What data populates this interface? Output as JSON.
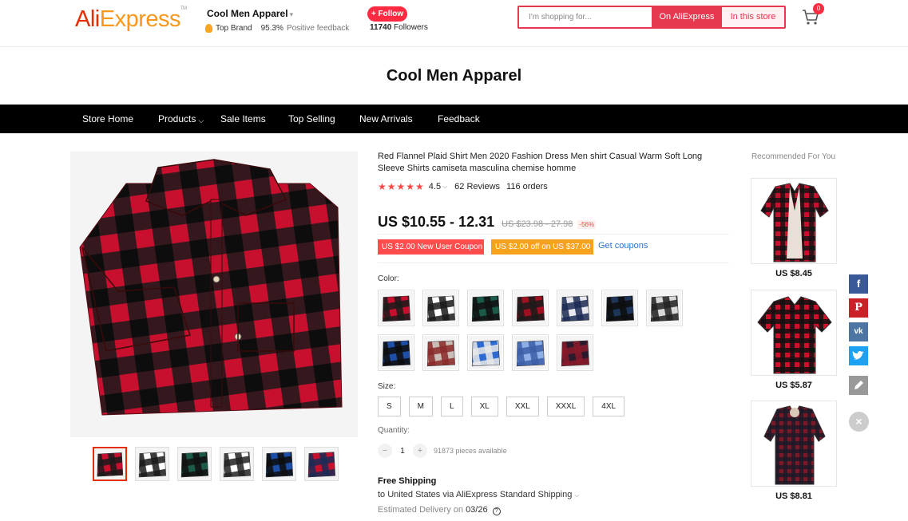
{
  "header": {
    "logo_ali": "Ali",
    "logo_express": "Express",
    "logo_tm": "TM",
    "store_name": "Cool Men Apparel",
    "top_brand": "Top Brand",
    "feedback_pct": "95.3%",
    "feedback_label": "Positive feedback",
    "follow_label": "+ Follow",
    "followers_count": "11740",
    "followers_label": "Followers",
    "search_placeholder": "I'm shopping for...",
    "search_btn_ali": "On AliExpress",
    "search_btn_store": "In this store",
    "cart_count": "0"
  },
  "banner": {
    "title": "Cool Men Apparel"
  },
  "nav": {
    "items": [
      {
        "label": "Store Home"
      },
      {
        "label": "Products"
      },
      {
        "label": "Sale Items"
      },
      {
        "label": "Top Selling"
      },
      {
        "label": "New Arrivals"
      },
      {
        "label": "Feedback"
      }
    ]
  },
  "product": {
    "title": "Red Flannel Plaid Shirt Men 2020 Fashion Dress Men shirt Casual Warm Soft Long Sleeve Shirts camiseta masculina chemise homme",
    "stars": "★★★★★",
    "rating": "4.5",
    "reviews": "62 Reviews",
    "orders": "116 orders",
    "price": "US $10.55 - 12.31",
    "old_price": "US $23.98 - 27.98",
    "discount": "-56%",
    "coupon_new_user": "US $2.00 New User Coupon",
    "coupon_off": "US $2.00 off on US $37.00",
    "get_coupons": "Get coupons",
    "color_label": "Color:",
    "size_label": "Size:",
    "sizes": [
      "S",
      "M",
      "L",
      "XL",
      "XXL",
      "XXXL",
      "4XL"
    ],
    "quantity_label": "Quantity:",
    "quantity_value": "1",
    "quantity_available": "91873 pieces available",
    "shipping_title": "Free Shipping",
    "shipping_to": "to United States via AliExpress Standard Shipping",
    "delivery_label": "Estimated Delivery on",
    "delivery_date": "03/26"
  },
  "colors": {
    "swatches": [
      {
        "c1": "#c8102e",
        "c2": "#1a1a1a",
        "bg": "#f4f4f4"
      },
      {
        "c1": "#ffffff",
        "c2": "#1a1a1a",
        "bg": "#f4f4f4"
      },
      {
        "c1": "#1c5a4a",
        "c2": "#111111",
        "bg": "#f4f4f4"
      },
      {
        "c1": "#a0101f",
        "c2": "#1a1a1a",
        "bg": "#f4f4f4"
      },
      {
        "c1": "#e8e8ee",
        "c2": "#1b2a55",
        "bg": "#f4f4f4"
      },
      {
        "c1": "#1d3558",
        "c2": "#0d0d0d",
        "bg": "#f4f4f4"
      },
      {
        "c1": "#d8d8d8",
        "c2": "#222222",
        "bg": "#f4f4f4"
      },
      {
        "c1": "#1e4fa8",
        "c2": "#0d0d0d",
        "bg": "#f4f4f4"
      },
      {
        "c1": "#c9bdb5",
        "c2": "#8a2a2a",
        "bg": "#f4f4f4"
      },
      {
        "c1": "#2d6ad1",
        "c2": "#e8e8e8",
        "bg": "#f4f4f4"
      },
      {
        "c1": "#8fb0e6",
        "c2": "#3d5fa8",
        "bg": "#f4f4f4"
      },
      {
        "c1": "#2a1a2e",
        "c2": "#8a1a2a",
        "bg": "#f4f4f4"
      }
    ],
    "thumbs": [
      {
        "c1": "#c8102e",
        "c2": "#1a1a1a"
      },
      {
        "c1": "#ffffff",
        "c2": "#1a1a1a"
      },
      {
        "c1": "#1c5a4a",
        "c2": "#111111"
      },
      {
        "c1": "#ffffff",
        "c2": "#222222"
      },
      {
        "c1": "#1e4fa8",
        "c2": "#0d0d0d"
      },
      {
        "c1": "#c8102e",
        "c2": "#1b2a55"
      }
    ],
    "brand_red": "#e62e04",
    "accent_red": "#ff2b42"
  },
  "recommended": {
    "title": "Recommended For You",
    "items": [
      {
        "price": "US $8.45"
      },
      {
        "price": "US $5.87"
      },
      {
        "price": "US $8.81"
      }
    ]
  },
  "social": {
    "facebook": "f",
    "pinterest": "P",
    "vk": "vk",
    "close": "×"
  }
}
